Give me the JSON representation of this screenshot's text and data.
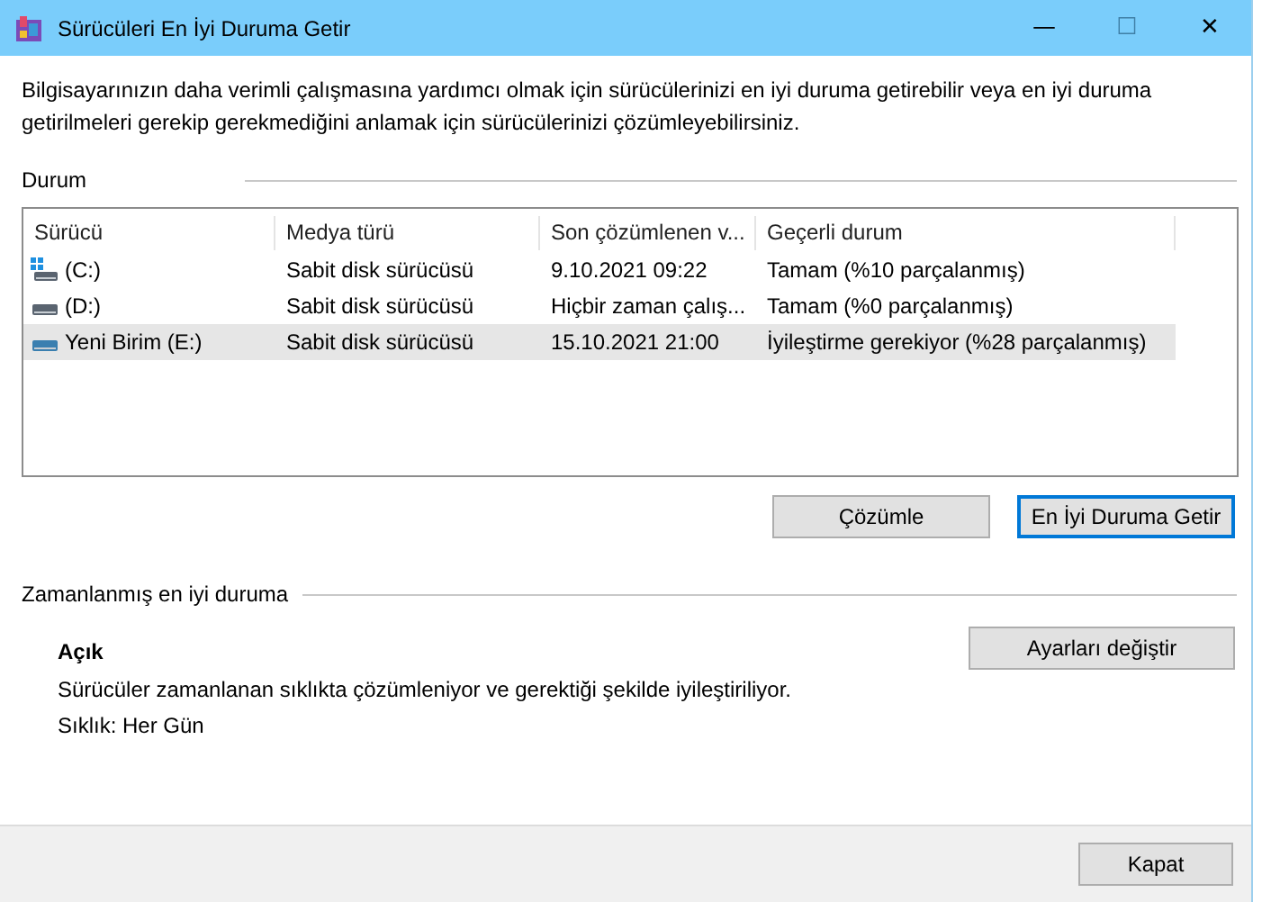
{
  "window": {
    "title": "Sürücüleri En İyi Duruma Getir",
    "controls": [
      "—",
      "☐",
      "✕"
    ]
  },
  "intro": "Bilgisayarınızın daha verimli çalışmasına yardımcı olmak için sürücülerinizi en iyi duruma getirebilir veya en iyi duruma getirilmeleri gerekip gerekmediğini anlamak için sürücülerinizi çözümleyebilirsiniz.",
  "status_section": {
    "title": "Durum"
  },
  "table": {
    "columns": [
      "Sürücü",
      "Medya türü",
      "Son çözümlenen v...",
      "Geçerli durum"
    ],
    "rows": [
      {
        "kind": "system",
        "selected": false,
        "cells": [
          "(C:)",
          "Sabit disk sürücüsü",
          "9.10.2021 09:22",
          "Tamam (%10 parçalanmış)"
        ]
      },
      {
        "kind": "disk",
        "selected": false,
        "cells": [
          "(D:)",
          "Sabit disk sürücüsü",
          "Hiçbir zaman çalış...",
          "Tamam (%0 parçalanmış)"
        ]
      },
      {
        "kind": "disk",
        "selected": true,
        "cells": [
          "Yeni Birim (E:)",
          "Sabit disk sürücüsü",
          "15.10.2021 21:00",
          "İyileştirme gerekiyor (%28 parçalanmış)"
        ]
      }
    ]
  },
  "actions": [
    {
      "label": "Çözümle",
      "default": false
    },
    {
      "label": "En İyi Duruma Getir",
      "default": true
    }
  ],
  "schedule": {
    "title": "Zamanlanmış en iyi duruma",
    "state": "Açık",
    "description": "Sürücüler zamanlanan sıklıkta çözümleniyor ve gerektiği şekilde iyileştiriliyor.",
    "frequency": "Sıklık: Her Gün",
    "button": "Ayarları değiştir"
  },
  "footer": {
    "button": "Kapat"
  }
}
